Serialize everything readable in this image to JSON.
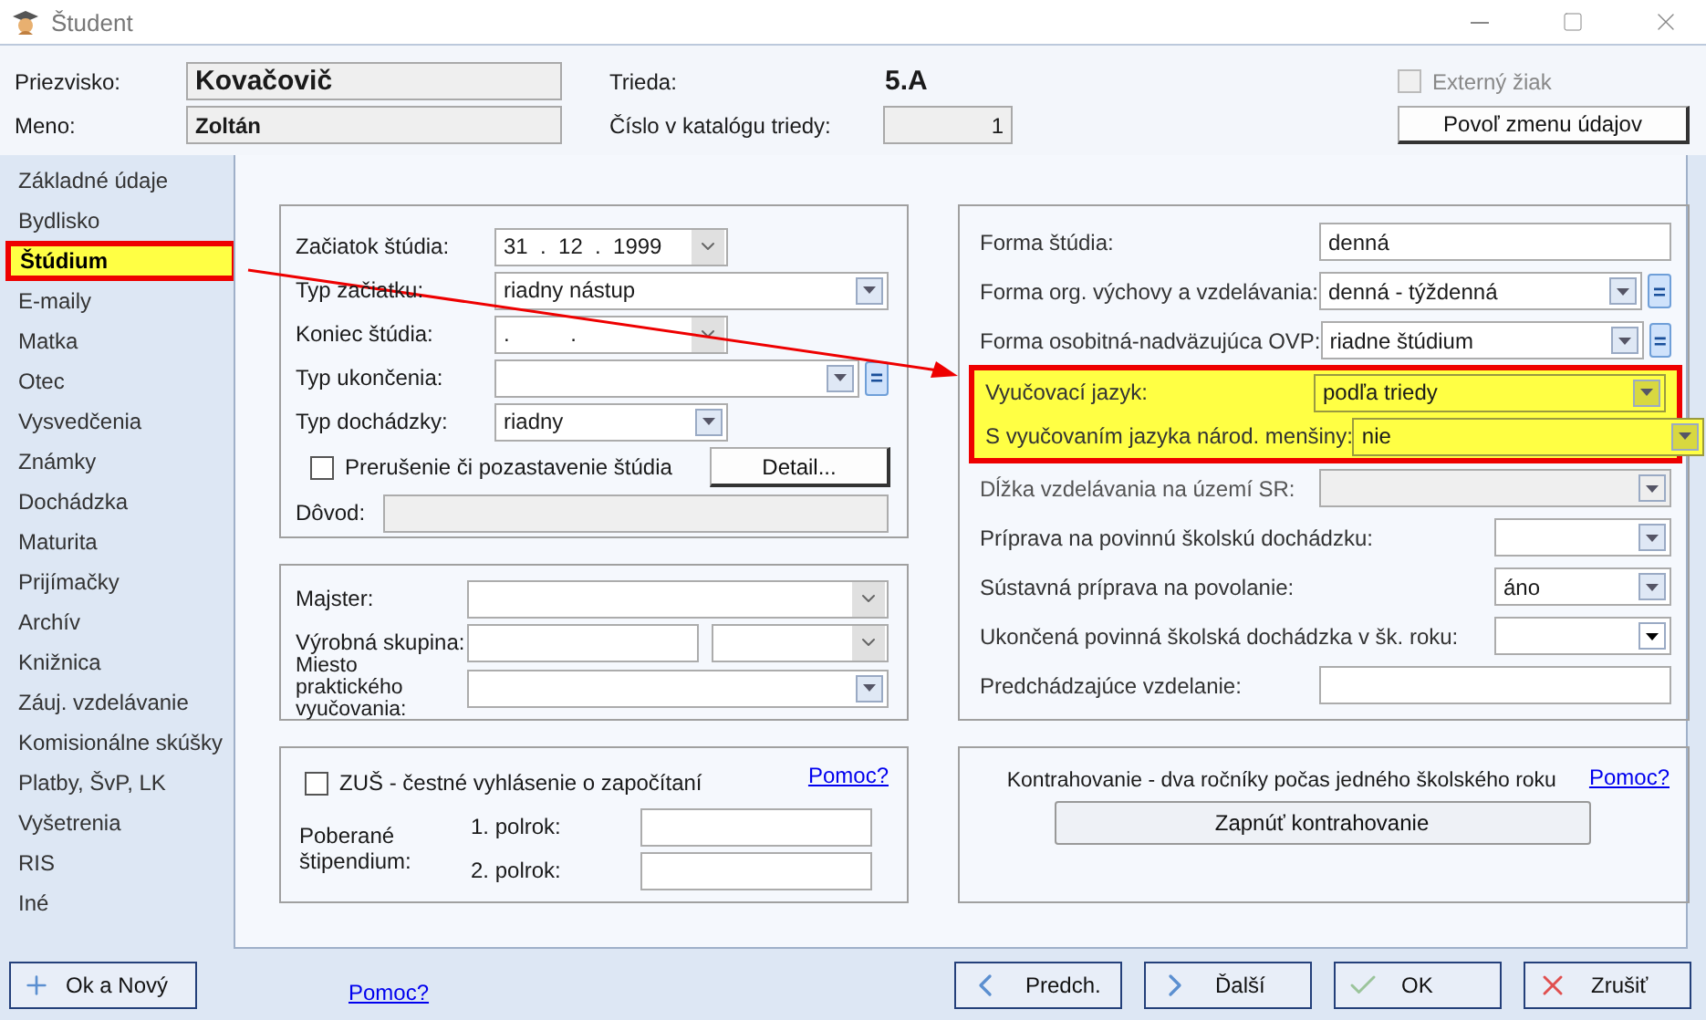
{
  "window": {
    "title": "Študent"
  },
  "header": {
    "surname": {
      "label": "Priezvisko:",
      "value": "Kovačovič"
    },
    "name": {
      "label": "Meno:",
      "value": "Zoltán"
    },
    "class": {
      "label": "Trieda:",
      "value": "5.A"
    },
    "catalog": {
      "label": "Číslo v katalógu triedy:",
      "value": "1"
    },
    "external": {
      "label": "Externý žiak",
      "checked": false,
      "disabled": true
    },
    "button": "Povoľ zmenu údajov"
  },
  "sidebar": {
    "items": [
      {
        "label": "Základné údaje",
        "selected": false
      },
      {
        "label": "Bydlisko",
        "selected": false
      },
      {
        "label": "Štúdium",
        "selected": true
      },
      {
        "label": "E-maily",
        "selected": false
      },
      {
        "label": "Matka",
        "selected": false
      },
      {
        "label": "Otec",
        "selected": false
      },
      {
        "label": "Vysvedčenia",
        "selected": false
      },
      {
        "label": "Známky",
        "selected": false
      },
      {
        "label": "Dochádzka",
        "selected": false
      },
      {
        "label": "Maturita",
        "selected": false
      },
      {
        "label": "Prijímačky",
        "selected": false
      },
      {
        "label": "Archív",
        "selected": false
      },
      {
        "label": "Knižnica",
        "selected": false
      },
      {
        "label": "Záuj. vzdelávanie",
        "selected": false
      },
      {
        "label": "Komisionálne skúšky",
        "selected": false
      },
      {
        "label": "Platby, ŠvP, LK",
        "selected": false
      },
      {
        "label": "Vyšetrenia",
        "selected": false
      },
      {
        "label": "RIS",
        "selected": false
      },
      {
        "label": "Iné",
        "selected": false
      }
    ]
  },
  "study": {
    "rows": [
      {
        "label": "Začiatok štúdia:",
        "kind": "date",
        "value": "31  .  12  .  1999"
      },
      {
        "label": "Typ začiatku:",
        "kind": "combo",
        "value": "riadny nástup"
      },
      {
        "label": "Koniec štúdia:",
        "kind": "date",
        "value": ".          ."
      },
      {
        "label": "Typ ukončenia:",
        "kind": "combo-eq",
        "value": "",
        "extra_button": "="
      },
      {
        "label": "Typ dochádzky:",
        "kind": "combo-short",
        "value": "riadny"
      }
    ],
    "interruption": {
      "label": "Prerušenie či pozastavenie štúdia",
      "checked": false
    },
    "detail_button": "Detail...",
    "reason": {
      "label": "Dôvod:",
      "disabled": true
    }
  },
  "practice": {
    "master": {
      "label": "Majster:"
    },
    "group": {
      "label": "Výrobná skupina:"
    },
    "place": {
      "label": "Miesto praktického vyučovania:"
    }
  },
  "zus": {
    "checkbox": {
      "label": "ZUŠ - čestné vyhlásenie o započítaní",
      "checked": false
    },
    "help": "Pomoc?",
    "stipend": "Poberané štipendium:",
    "terms": [
      "1. polrok:",
      "2. polrok:"
    ]
  },
  "form": {
    "rows": [
      {
        "label": "Forma štúdia:",
        "kind": "text",
        "value": "denná",
        "highlighted": false,
        "disabled": false
      },
      {
        "label": "Forma org. výchovy a vzdelávania:",
        "kind": "combo-eq",
        "value": "denná - týždenná",
        "extra_button": "=",
        "highlighted": false,
        "disabled": false
      },
      {
        "label": "Forma osobitná-nadväzujúca OVP:",
        "kind": "combo-eq",
        "value": "riadne štúdium",
        "extra_button": "=",
        "highlighted": false,
        "disabled": false
      },
      {
        "label": "Vyučovací jazyk:",
        "kind": "combo",
        "value": "podľa triedy",
        "highlighted": true,
        "disabled": false
      },
      {
        "label": "S vyučovaním jazyka národ. menšiny:",
        "kind": "combo",
        "value": "nie",
        "highlighted": true,
        "disabled": false
      },
      {
        "label": "Dĺžka vzdelávania na území SR:",
        "kind": "combo",
        "value": "",
        "highlighted": false,
        "disabled": true
      },
      {
        "label": "Príprava na povinnú školskú dochádzku:",
        "kind": "combo-short",
        "value": "",
        "highlighted": false,
        "disabled": false
      },
      {
        "label": "Sústavná príprava na povolanie:",
        "kind": "combo-short",
        "value": "áno",
        "highlighted": false,
        "disabled": false
      },
      {
        "label": "Ukončená povinná školská dochádzka v šk. roku:",
        "kind": "combo-dark",
        "value": "",
        "highlighted": false,
        "disabled": false
      },
      {
        "label": "Predchádzajúce vzdelanie:",
        "kind": "text",
        "value": "",
        "highlighted": false,
        "disabled": false
      }
    ]
  },
  "contracting": {
    "text": "Kontrahovanie - dva ročníky počas jedného školského roku",
    "help": "Pomoc?",
    "button": "Zapnúť kontrahovanie"
  },
  "footer": {
    "ok_new": "Ok a Nový",
    "help": "Pomoc?",
    "buttons": [
      {
        "kind": "prev",
        "label": "Predch."
      },
      {
        "kind": "next",
        "label": "Ďalší"
      },
      {
        "kind": "ok",
        "label": "OK"
      },
      {
        "kind": "cancel",
        "label": "Zrušiť"
      }
    ]
  }
}
